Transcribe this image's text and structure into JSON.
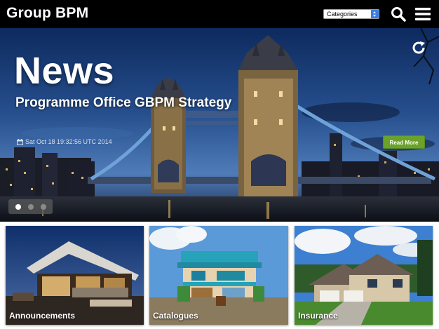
{
  "header": {
    "title": "Group BPM",
    "categories_label": "Categories",
    "search_icon": "search-icon",
    "menu_icon": "hamburger-menu-icon"
  },
  "hero": {
    "heading": "News",
    "subtitle": "Programme Office GBPM Strategy",
    "date": "Sat Oct 18 19:32:56 UTC 2014",
    "read_more": "Read More",
    "refresh_icon": "refresh-icon",
    "calendar_icon": "calendar-icon",
    "slides_total": 3,
    "active_slide": 1,
    "accent_color": "#6aa22b"
  },
  "tiles": [
    {
      "label": "Announcements"
    },
    {
      "label": "Catalogues"
    },
    {
      "label": "Insurance"
    }
  ]
}
